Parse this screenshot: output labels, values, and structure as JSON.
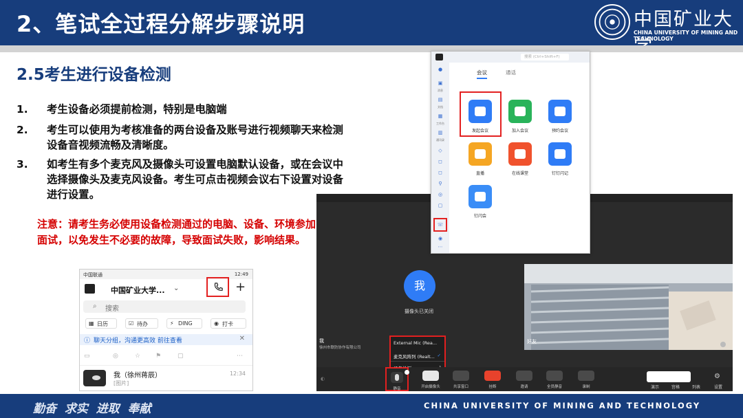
{
  "header": {
    "title": "2、笔试全过程分解步骤说明",
    "logo_cn": "中国矿业大学",
    "logo_en": "CHINA UNIVERSITY OF MINING AND TECHNOLOGY"
  },
  "section": {
    "title": "2.5考生进行设备检测"
  },
  "items": [
    {
      "num": "1.",
      "text": "考生设备必须提前检测，特别是电脑端"
    },
    {
      "num": "2.",
      "text": "考生可以使用为考核准备的两台设备及账号进行视频聊天来检测设备音视频流畅及清晰度。"
    },
    {
      "num": "3.",
      "text": "如考生有多个麦克风及摄像头可设置电脑默认设备，或在会议中选择摄像头及麦克风设备。考生可点击视频会议右下设置对设备进行设置。"
    }
  ],
  "note": "注意：请考生务必使用设备检测通过的电脑、设备、环境参加面试，以免发生不必要的故障，导致面试失败，影响结果。",
  "phone": {
    "carrier": "中国联通",
    "time": "12:49",
    "org": "中国矿业大学...",
    "search_placeholder": "搜索",
    "chips": [
      {
        "icon": "calendar-icon",
        "label": "日历"
      },
      {
        "icon": "todo-icon",
        "label": "待办"
      },
      {
        "icon": "ding-icon",
        "label": "DING"
      },
      {
        "icon": "checkin-icon",
        "label": "打卡"
      }
    ],
    "info": "聊天分组，沟通更高效 前往查看",
    "chat_name": "我（徐州蒋辰）",
    "chat_time": "12:34",
    "chat_msg": "[图片]"
  },
  "meeting": {
    "avatar_text": "我",
    "cam_off": "摄像头已关闭",
    "self_label": "我",
    "self_org": "徐州市联防协作有限公司",
    "remote_label": "好友",
    "popup": {
      "item1": "External Mic (Rea...",
      "item2": "麦克风阵列 (Realt...",
      "item3": "设备检测"
    },
    "toolbar": [
      {
        "key": "mute",
        "label": "静音"
      },
      {
        "key": "cam",
        "label": "开启摄像头"
      },
      {
        "key": "share",
        "label": "共享窗口"
      },
      {
        "key": "end",
        "label": "挂断"
      },
      {
        "key": "invite",
        "label": "邀请"
      },
      {
        "key": "all_mute",
        "label": "全员静音"
      },
      {
        "key": "record",
        "label": "录制"
      }
    ],
    "right_labels": [
      "演示",
      "宫格",
      "列表",
      "设置"
    ]
  },
  "app": {
    "search": "搜索 (Ctrl+Shift+F)",
    "tab_meeting": "会议",
    "tab_call": "通话",
    "side_labels": [
      "消息",
      "文档",
      "工作台",
      "通讯录"
    ],
    "apps": [
      {
        "label": "发起会议",
        "color": "#2f7cf6"
      },
      {
        "label": "加入会议",
        "color": "#29b35a"
      },
      {
        "label": "预约会议",
        "color": "#2f7cf6"
      },
      {
        "label": "直播",
        "color": "#f5a623"
      },
      {
        "label": "在线课堂",
        "color": "#f0522d"
      },
      {
        "label": "钉钉闪记",
        "color": "#2f7cf6"
      },
      {
        "label": "钉闪会",
        "color": "#3a8df7"
      }
    ]
  },
  "footer": {
    "motto": "勤奋  求实  进取  奉献",
    "en": "CHINA UNIVERSITY OF MINING AND TECHNOLOGY"
  }
}
